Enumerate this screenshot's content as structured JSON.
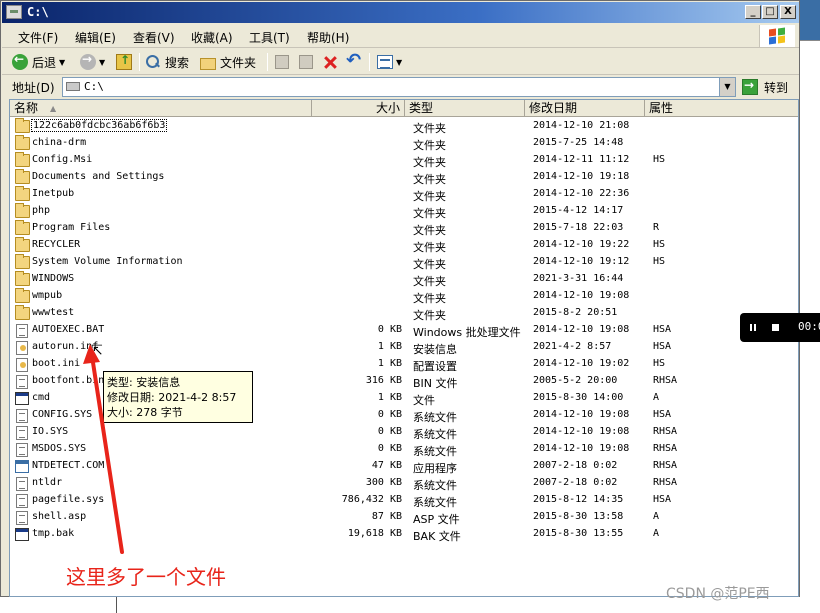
{
  "window": {
    "title": "C:\\",
    "controls": {
      "minimize": "_",
      "maximize": "□",
      "close": "X"
    }
  },
  "menu": [
    "文件(F)",
    "编辑(E)",
    "查看(V)",
    "收藏(A)",
    "工具(T)",
    "帮助(H)"
  ],
  "toolbar": {
    "back_label": "后退",
    "search_label": "搜索",
    "folders_label": "文件夹"
  },
  "address": {
    "label": "地址(D)",
    "value": "C:\\",
    "go_label": "转到"
  },
  "columns": {
    "name": "名称",
    "size": "大小",
    "type": "类型",
    "date": "修改日期",
    "attr": "属性"
  },
  "files": [
    {
      "name": "122c6ab0fdcbc36ab6f6b3",
      "size": "",
      "type": "文件夹",
      "date": "2014-12-10 21:08",
      "attr": "",
      "icon": "folder-icon"
    },
    {
      "name": "china-drm",
      "size": "",
      "type": "文件夹",
      "date": "2015-7-25 14:48",
      "attr": "",
      "icon": "folder-icon"
    },
    {
      "name": "Config.Msi",
      "size": "",
      "type": "文件夹",
      "date": "2014-12-11 11:12",
      "attr": "HS",
      "icon": "folder-icon"
    },
    {
      "name": "Documents and Settings",
      "size": "",
      "type": "文件夹",
      "date": "2014-12-10 19:18",
      "attr": "",
      "icon": "folder-icon"
    },
    {
      "name": "Inetpub",
      "size": "",
      "type": "文件夹",
      "date": "2014-12-10 22:36",
      "attr": "",
      "icon": "folder-icon"
    },
    {
      "name": "php",
      "size": "",
      "type": "文件夹",
      "date": "2015-4-12 14:17",
      "attr": "",
      "icon": "folder-icon"
    },
    {
      "name": "Program Files",
      "size": "",
      "type": "文件夹",
      "date": "2015-7-18 22:03",
      "attr": "R",
      "icon": "folder-icon"
    },
    {
      "name": "RECYCLER",
      "size": "",
      "type": "文件夹",
      "date": "2014-12-10 19:22",
      "attr": "HS",
      "icon": "folder-icon"
    },
    {
      "name": "System Volume Information",
      "size": "",
      "type": "文件夹",
      "date": "2014-12-10 19:12",
      "attr": "HS",
      "icon": "folder-icon"
    },
    {
      "name": "WINDOWS",
      "size": "",
      "type": "文件夹",
      "date": "2021-3-31 16:44",
      "attr": "",
      "icon": "folder-icon"
    },
    {
      "name": "wmpub",
      "size": "",
      "type": "文件夹",
      "date": "2014-12-10 19:08",
      "attr": "",
      "icon": "folder-icon"
    },
    {
      "name": "wwwtest",
      "size": "",
      "type": "文件夹",
      "date": "2015-8-2 20:51",
      "attr": "",
      "icon": "folder-icon"
    },
    {
      "name": "AUTOEXEC.BAT",
      "size": "0 KB",
      "type": "Windows 批处理文件",
      "date": "2014-12-10 19:08",
      "attr": "HSA",
      "icon": "batch-file-icon"
    },
    {
      "name": "autorun.inf",
      "size": "1 KB",
      "type": "安装信息",
      "date": "2021-4-2 8:57",
      "attr": "HSA",
      "icon": "setup-info-icon"
    },
    {
      "name": "boot.ini",
      "size": "1 KB",
      "type": "配置设置",
      "date": "2014-12-10 19:02",
      "attr": "HS",
      "icon": "config-file-icon"
    },
    {
      "name": "bootfont.bin",
      "size": "316 KB",
      "type": "BIN 文件",
      "date": "2005-5-2 20:00",
      "attr": "RHSA",
      "icon": "system-file-icon"
    },
    {
      "name": "cmd",
      "size": "1 KB",
      "type": "文件",
      "date": "2015-8-30 14:00",
      "attr": "A",
      "icon": "cmd-file-icon"
    },
    {
      "name": "CONFIG.SYS",
      "size": "0 KB",
      "type": "系统文件",
      "date": "2014-12-10 19:08",
      "attr": "HSA",
      "icon": "system-file-icon"
    },
    {
      "name": "IO.SYS",
      "size": "0 KB",
      "type": "系统文件",
      "date": "2014-12-10 19:08",
      "attr": "RHSA",
      "icon": "system-file-icon"
    },
    {
      "name": "MSDOS.SYS",
      "size": "0 KB",
      "type": "系统文件",
      "date": "2014-12-10 19:08",
      "attr": "RHSA",
      "icon": "system-file-icon"
    },
    {
      "name": "NTDETECT.COM",
      "size": "47 KB",
      "type": "应用程序",
      "date": "2007-2-18 0:02",
      "attr": "RHSA",
      "icon": "application-icon"
    },
    {
      "name": "ntldr",
      "size": "300 KB",
      "type": "系统文件",
      "date": "2007-2-18 0:02",
      "attr": "RHSA",
      "icon": "system-file-icon"
    },
    {
      "name": "pagefile.sys",
      "size": "786,432 KB",
      "type": "系统文件",
      "date": "2015-8-12 14:35",
      "attr": "HSA",
      "icon": "system-file-icon"
    },
    {
      "name": "shell.asp",
      "size": "87 KB",
      "type": "ASP 文件",
      "date": "2015-8-30 13:58",
      "attr": "A",
      "icon": "asp-file-icon"
    },
    {
      "name": "tmp.bak",
      "size": "19,618 KB",
      "type": "BAK 文件",
      "date": "2015-8-30 13:55",
      "attr": "A",
      "icon": "cmd-file-icon"
    }
  ],
  "tooltip": {
    "type_line": "类型: 安装信息",
    "date_line": "修改日期: 2021-4-2 8:57",
    "size_line": "大小: 278 字节"
  },
  "annotation": {
    "text": "这里多了一个文件",
    "color": "#e8241a"
  },
  "watermark": "CSDN @范PE西",
  "media": {
    "time": "00:0"
  },
  "colors": {
    "titlebar_start": "#0a246a",
    "titlebar_end": "#a6caf0",
    "chrome": "#ece9d8",
    "tooltip_bg": "#ffffe1"
  }
}
